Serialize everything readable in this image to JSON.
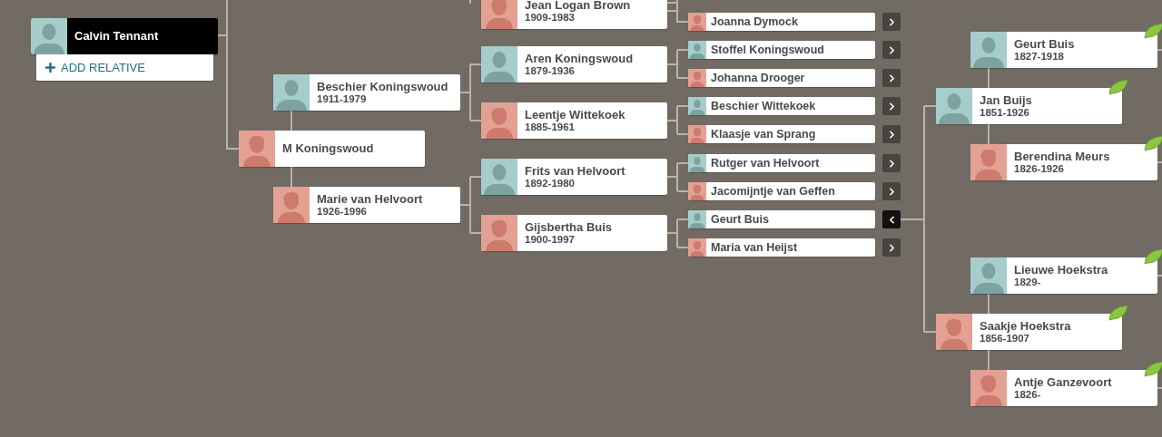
{
  "root": {
    "name": "Calvin Tennant",
    "kind": "male",
    "selected": true
  },
  "add_relative": {
    "label": "ADD RELATIVE"
  },
  "people": [
    {
      "kind": "male",
      "name": "Beschier Koningswoud",
      "dates": "1911-1979",
      "hint": false,
      "selected": false
    },
    {
      "kind": "female",
      "name": "M Koningswoud",
      "hint": false,
      "selected": false
    },
    {
      "kind": "female",
      "name": "Marie van Helvoort",
      "dates": "1926-1996",
      "hint": false,
      "selected": false
    },
    {
      "kind": "female",
      "name": "Jean Logan Brown",
      "dates": "1909-1983",
      "hint": false,
      "selected": false
    },
    {
      "kind": "male",
      "name": "Aren Koningswoud",
      "dates": "1879-1936",
      "hint": false,
      "selected": false
    },
    {
      "kind": "female",
      "name": "Leentje Wittekoek",
      "dates": "1885-1961",
      "hint": false,
      "selected": false
    },
    {
      "kind": "male",
      "name": "Frits van Helvoort",
      "dates": "1892-1980",
      "hint": false,
      "selected": false
    },
    {
      "kind": "female",
      "name": "Gijsbertha Buis",
      "dates": "1900-1997",
      "hint": false,
      "selected": false
    },
    {
      "kind": "female",
      "name": "Joanna Dymock",
      "expanded": false,
      "selected": false
    },
    {
      "kind": "male",
      "name": "Stoffel Koningswoud",
      "expanded": false,
      "selected": false
    },
    {
      "kind": "female",
      "name": "Johanna Drooger",
      "expanded": false,
      "selected": false
    },
    {
      "kind": "male",
      "name": "Beschier Wittekoek",
      "expanded": false,
      "selected": false
    },
    {
      "kind": "female",
      "name": "Klaasje van Sprang",
      "expanded": false,
      "selected": false
    },
    {
      "kind": "male",
      "name": "Rutger van Helvoort",
      "expanded": false,
      "selected": false
    },
    {
      "kind": "female",
      "name": "Jacomijntje van Geffen",
      "expanded": false,
      "selected": false
    },
    {
      "kind": "male",
      "name": "Geurt Buis",
      "expanded": true,
      "selected": false
    },
    {
      "kind": "female",
      "name": "Maria van Heijst",
      "expanded": false,
      "selected": false
    },
    {
      "kind": "male",
      "name": "Geurt Buis",
      "dates": "1827-1918",
      "hint": true,
      "selected": false
    },
    {
      "kind": "male",
      "name": "Jan Buijs",
      "dates": "1851-1926",
      "hint": true,
      "selected": false
    },
    {
      "kind": "female",
      "name": "Berendina Meurs",
      "dates": "1826-1926",
      "hint": true,
      "selected": false
    },
    {
      "kind": "male",
      "name": "Lieuwe Hoekstra",
      "dates": "1829-",
      "hint": true,
      "selected": false
    },
    {
      "kind": "female",
      "name": "Saakje Hoekstra",
      "dates": "1856-1907",
      "hint": true,
      "selected": false
    },
    {
      "kind": "female",
      "name": "Antje Ganzevoort",
      "dates": "1826-",
      "hint": true,
      "selected": false
    }
  ]
}
